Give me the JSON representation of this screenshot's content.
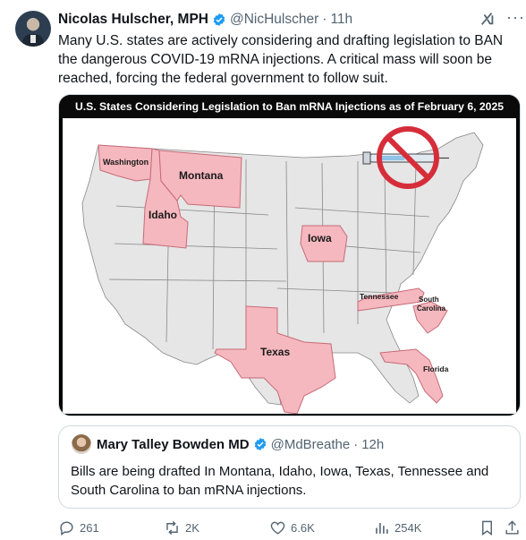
{
  "post": {
    "author_name": "Nicolas Hulscher, MPH",
    "handle": "@NicHulscher",
    "separator": "·",
    "time": "11h",
    "text": "Many U.S. states are actively considering and drafting legislation to BAN the dangerous COVID-19 mRNA injections. A critical mass will soon be reached, forcing the federal government to follow suit."
  },
  "media": {
    "title": "U.S. States Considering Legislation to Ban mRNA Injections as of February 6, 2025",
    "highlight_color": "#f5b8be",
    "base_state_color": "#e6e6e6",
    "states": {
      "washington": "Washington",
      "montana": "Montana",
      "idaho": "Idaho",
      "iowa": "Iowa",
      "texas": "Texas",
      "tennessee": "Tennessee",
      "south_carolina_1": "South",
      "south_carolina_2": "Carolina",
      "florida": "Florida"
    }
  },
  "quote": {
    "author_name": "Mary Talley Bowden MD",
    "handle": "@MdBreathe",
    "separator": "·",
    "time": "12h",
    "text": "Bills are being drafted In Montana, Idaho, Iowa, Texas, Tennessee and South Carolina to ban mRNA injections."
  },
  "actions": {
    "replies": "261",
    "reposts": "2K",
    "likes": "6.6K",
    "views": "254K"
  },
  "colors": {
    "verified": "#1d9bf0",
    "secondary_text": "#536471",
    "primary_text": "#0f1419"
  }
}
